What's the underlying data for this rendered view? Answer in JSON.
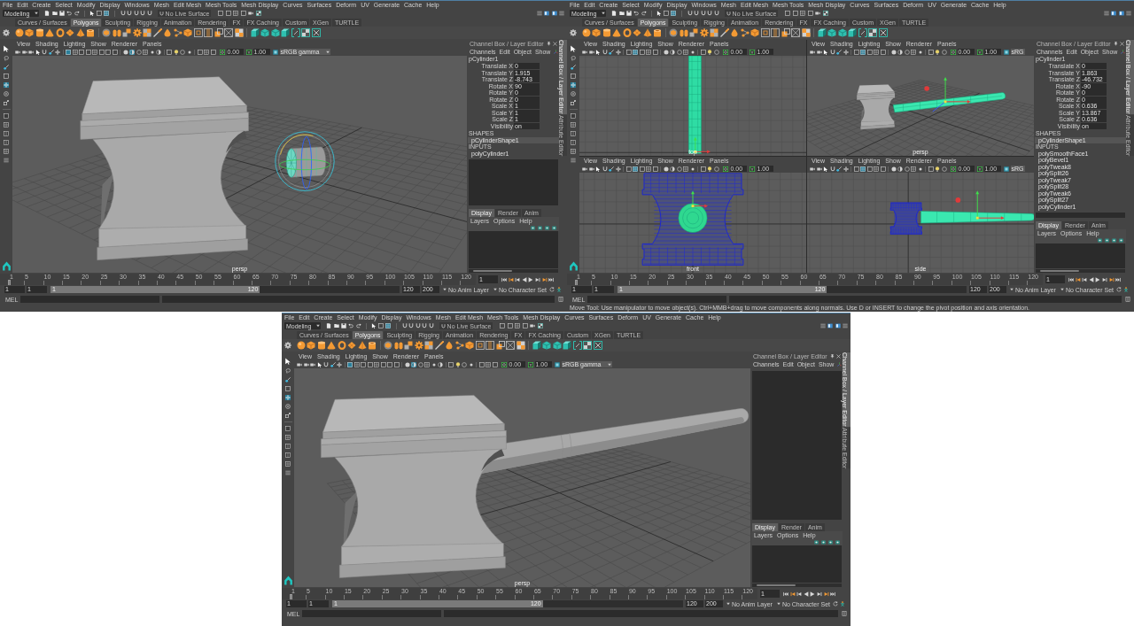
{
  "windows": [
    {
      "menu_bar": [
        "File",
        "Edit",
        "Create",
        "Select",
        "Modify",
        "Display",
        "Windows",
        "Mesh",
        "Edit Mesh",
        "Mesh Tools",
        "Mesh Display",
        "Curves",
        "Surfaces",
        "Deform",
        "UV",
        "Generate",
        "Cache",
        "Help"
      ],
      "mode": "Modeling",
      "live_surface": "No Live Surface",
      "shelf_tabs": [
        {
          "label": "Curves / Surfaces",
          "selected": false
        },
        {
          "label": "Polygons",
          "selected": true
        },
        {
          "label": "Sculpting",
          "selected": false
        },
        {
          "label": "Rigging",
          "selected": false
        },
        {
          "label": "Animation",
          "selected": false
        },
        {
          "label": "Rendering",
          "selected": false
        },
        {
          "label": "FX",
          "selected": false
        },
        {
          "label": "FX Caching",
          "selected": false
        },
        {
          "label": "Custom",
          "selected": false
        },
        {
          "label": "XGen",
          "selected": false
        },
        {
          "label": "TURTLE",
          "selected": false
        }
      ],
      "viewports": [
        {
          "menu": [
            "View",
            "Shading",
            "Lighting",
            "Show",
            "Renderer",
            "Panels"
          ],
          "exposure": "0.00",
          "gamma": "1.00",
          "color_space": "sRGB gamma",
          "camera": "persp"
        }
      ],
      "channel_box": {
        "title": "Channel Box / Layer Editor",
        "menu": [
          "Channels",
          "Edit",
          "Object",
          "Show"
        ],
        "object": "pCylinder1",
        "channels": [
          {
            "name": "Translate X",
            "value": "0"
          },
          {
            "name": "Translate Y",
            "value": "1.915"
          },
          {
            "name": "Translate Z",
            "value": "-8.743"
          },
          {
            "name": "Rotate X",
            "value": "90"
          },
          {
            "name": "Rotate Y",
            "value": "0"
          },
          {
            "name": "Rotate Z",
            "value": "0"
          },
          {
            "name": "Scale X",
            "value": "1"
          },
          {
            "name": "Scale Y",
            "value": "1"
          },
          {
            "name": "Scale Z",
            "value": "1"
          },
          {
            "name": "Visibility",
            "value": "on"
          }
        ],
        "shapes_heading": "SHAPES",
        "shapes": [
          {
            "label": "pCylinderShape1",
            "selected": true
          }
        ],
        "inputs_heading": "INPUTS",
        "inputs": [
          "polyCylinder1"
        ]
      },
      "layer_editor": {
        "tabs": [
          {
            "label": "Display",
            "selected": true
          },
          {
            "label": "Render",
            "selected": false
          },
          {
            "label": "Anim",
            "selected": false
          }
        ],
        "menu": [
          "Layers",
          "Options",
          "Help"
        ]
      },
      "side_tabs": [
        {
          "label": "Channel Box / Layer Editor",
          "selected": true
        },
        {
          "label": "Attribute Editor",
          "selected": false
        }
      ],
      "time_slider": {
        "ticks": [
          "1",
          "5",
          "10",
          "15",
          "20",
          "25",
          "30",
          "35",
          "40",
          "45",
          "50",
          "55",
          "60",
          "65",
          "70",
          "75",
          "80",
          "85",
          "90",
          "95",
          "100",
          "105",
          "110",
          "115",
          "120"
        ],
        "level": 0,
        "current_frame": "1"
      },
      "range_slider": {
        "start": "1",
        "playback_start": "1",
        "level": 0.6,
        "bar_start": "1",
        "bar_end": "120",
        "playback_end": "120",
        "end": "200",
        "anim_layer": "No Anim Layer",
        "character_set": "No Character Set"
      },
      "command_line": {
        "language": "MEL"
      }
    },
    {
      "menu_bar": [
        "File",
        "Edit",
        "Create",
        "Select",
        "Modify",
        "Display",
        "Windows",
        "Mesh",
        "Edit Mesh",
        "Mesh Tools",
        "Mesh Display",
        "Curves",
        "Surfaces",
        "Deform",
        "UV",
        "Generate",
        "Cache",
        "Help"
      ],
      "mode": "Modeling",
      "live_surface": "No Live Surface",
      "shelf_tabs": [
        {
          "label": "Curves / Surfaces",
          "selected": false
        },
        {
          "label": "Polygons",
          "selected": true
        },
        {
          "label": "Sculpting",
          "selected": false
        },
        {
          "label": "Rigging",
          "selected": false
        },
        {
          "label": "Animation",
          "selected": false
        },
        {
          "label": "Rendering",
          "selected": false
        },
        {
          "label": "FX",
          "selected": false
        },
        {
          "label": "FX Caching",
          "selected": false
        },
        {
          "label": "Custom",
          "selected": false
        },
        {
          "label": "XGen",
          "selected": false
        },
        {
          "label": "TURTLE",
          "selected": false
        }
      ],
      "viewports": [
        {
          "menu": [
            "View",
            "Shading",
            "Lighting",
            "Show",
            "Renderer",
            "Panels"
          ],
          "exposure": "0.00",
          "gamma": "1.00",
          "camera": "top"
        },
        {
          "menu": [
            "View",
            "Shading",
            "Lighting",
            "Show",
            "Renderer",
            "Panels"
          ],
          "exposure": "0.00",
          "gamma": "1.00",
          "color_space": "sRG",
          "camera": "persp"
        },
        {
          "menu": [
            "View",
            "Shading",
            "Lighting",
            "Show",
            "Renderer",
            "Panels"
          ],
          "exposure": "0.00",
          "gamma": "1.00",
          "camera": "front"
        },
        {
          "menu": [
            "View",
            "Shading",
            "Lighting",
            "Show",
            "Renderer",
            "Panels"
          ],
          "exposure": "0.00",
          "gamma": "1.00",
          "color_space": "sRG",
          "camera": "side"
        }
      ],
      "channel_box": {
        "title": "Channel Box / Layer Editor",
        "menu": [
          "Channels",
          "Edit",
          "Object",
          "Show"
        ],
        "object": "pCylinder1",
        "channels": [
          {
            "name": "Translate X",
            "value": "0"
          },
          {
            "name": "Translate Y",
            "value": "1.863"
          },
          {
            "name": "Translate Z",
            "value": "-46.732"
          },
          {
            "name": "Rotate X",
            "value": "-90"
          },
          {
            "name": "Rotate Y",
            "value": "0"
          },
          {
            "name": "Rotate Z",
            "value": "0"
          },
          {
            "name": "Scale X",
            "value": "0.636"
          },
          {
            "name": "Scale Y",
            "value": "13.867"
          },
          {
            "name": "Scale Z",
            "value": "0.636"
          },
          {
            "name": "Visibility",
            "value": "on"
          }
        ],
        "shapes_heading": "SHAPES",
        "shapes": [
          {
            "label": "pCylinderShape1",
            "selected": true
          }
        ],
        "inputs_heading": "INPUTS",
        "inputs": [
          "polySmoothFace1",
          "polyBevel1",
          "polyTweak8",
          "polySplit26",
          "polyTweak7",
          "polySplit28",
          "polyTweak6",
          "polySplit27",
          "polyCylinder1"
        ]
      },
      "layer_editor": {
        "tabs": [
          {
            "label": "Display",
            "selected": true
          },
          {
            "label": "Render",
            "selected": false
          },
          {
            "label": "Anim",
            "selected": false
          }
        ],
        "menu": [
          "Layers",
          "Options",
          "Help"
        ]
      },
      "side_tabs": [
        {
          "label": "Channel Box / Layer Editor",
          "selected": true
        },
        {
          "label": "Attribute Editor",
          "selected": false
        }
      ],
      "time_slider": {
        "ticks": [
          "1",
          "5",
          "10",
          "15",
          "20",
          "25",
          "30",
          "35",
          "40",
          "45",
          "50",
          "55",
          "60",
          "65",
          "70",
          "75",
          "80",
          "85",
          "90",
          "95",
          "100",
          "105",
          "110",
          "115",
          "120"
        ],
        "level": 0,
        "current_frame": "1"
      },
      "range_slider": {
        "start": "1",
        "playback_start": "1",
        "level": 0.6,
        "bar_start": "1",
        "bar_end": "120",
        "playback_end": "120",
        "end": "200",
        "anim_layer": "No Anim Layer",
        "character_set": "No Character Set"
      },
      "command_line": {
        "language": "MEL"
      },
      "help_line": "Move Tool: Use manipulator to move object(s). Ctrl+MMB+drag to move components along normals. Use D or INSERT to change the pivot position and axis orientation."
    },
    {
      "menu_bar": [
        "File",
        "Edit",
        "Create",
        "Select",
        "Modify",
        "Display",
        "Windows",
        "Mesh",
        "Edit Mesh",
        "Mesh Tools",
        "Mesh Display",
        "Curves",
        "Surfaces",
        "Deform",
        "UV",
        "Generate",
        "Cache",
        "Help"
      ],
      "mode": "Modeling",
      "live_surface": "No Live Surface",
      "shelf_tabs": [
        {
          "label": "Curves / Surfaces",
          "selected": false
        },
        {
          "label": "Polygons",
          "selected": true
        },
        {
          "label": "Sculpting",
          "selected": false
        },
        {
          "label": "Rigging",
          "selected": false
        },
        {
          "label": "Animation",
          "selected": false
        },
        {
          "label": "Rendering",
          "selected": false
        },
        {
          "label": "FX",
          "selected": false
        },
        {
          "label": "FX Caching",
          "selected": false
        },
        {
          "label": "Custom",
          "selected": false
        },
        {
          "label": "XGen",
          "selected": false
        },
        {
          "label": "TURTLE",
          "selected": false
        }
      ],
      "viewports": [
        {
          "menu": [
            "View",
            "Shading",
            "Lighting",
            "Show",
            "Renderer",
            "Panels"
          ],
          "exposure": "0.00",
          "gamma": "1.00",
          "color_space": "sRGB gamma",
          "camera": "persp"
        }
      ],
      "channel_box": {
        "title": "Channel Box / Layer Editor",
        "menu": [
          "Channels",
          "Edit",
          "Object",
          "Show"
        ]
      },
      "layer_editor": {
        "tabs": [
          {
            "label": "Display",
            "selected": true
          },
          {
            "label": "Render",
            "selected": false
          },
          {
            "label": "Anim",
            "selected": false
          }
        ],
        "menu": [
          "Layers",
          "Options",
          "Help"
        ]
      },
      "side_tabs": [
        {
          "label": "Channel Box / Layer Editor",
          "selected": true
        },
        {
          "label": "Attribute Editor",
          "selected": false
        }
      ],
      "time_slider": {
        "ticks": [
          "1",
          "5",
          "10",
          "15",
          "20",
          "25",
          "30",
          "35",
          "40",
          "45",
          "50",
          "55",
          "60",
          "65",
          "70",
          "75",
          "80",
          "85",
          "90",
          "95",
          "100",
          "105",
          "110",
          "115",
          "120"
        ],
        "level": 0,
        "current_frame": "1"
      },
      "range_slider": {
        "start": "1",
        "playback_start": "1",
        "level": 0.6,
        "bar_start": "1",
        "bar_end": "120",
        "playback_end": "120",
        "end": "200",
        "anim_layer": "No Anim Layer",
        "character_set": "No Character Set"
      },
      "command_line": {
        "language": "MEL"
      }
    }
  ]
}
